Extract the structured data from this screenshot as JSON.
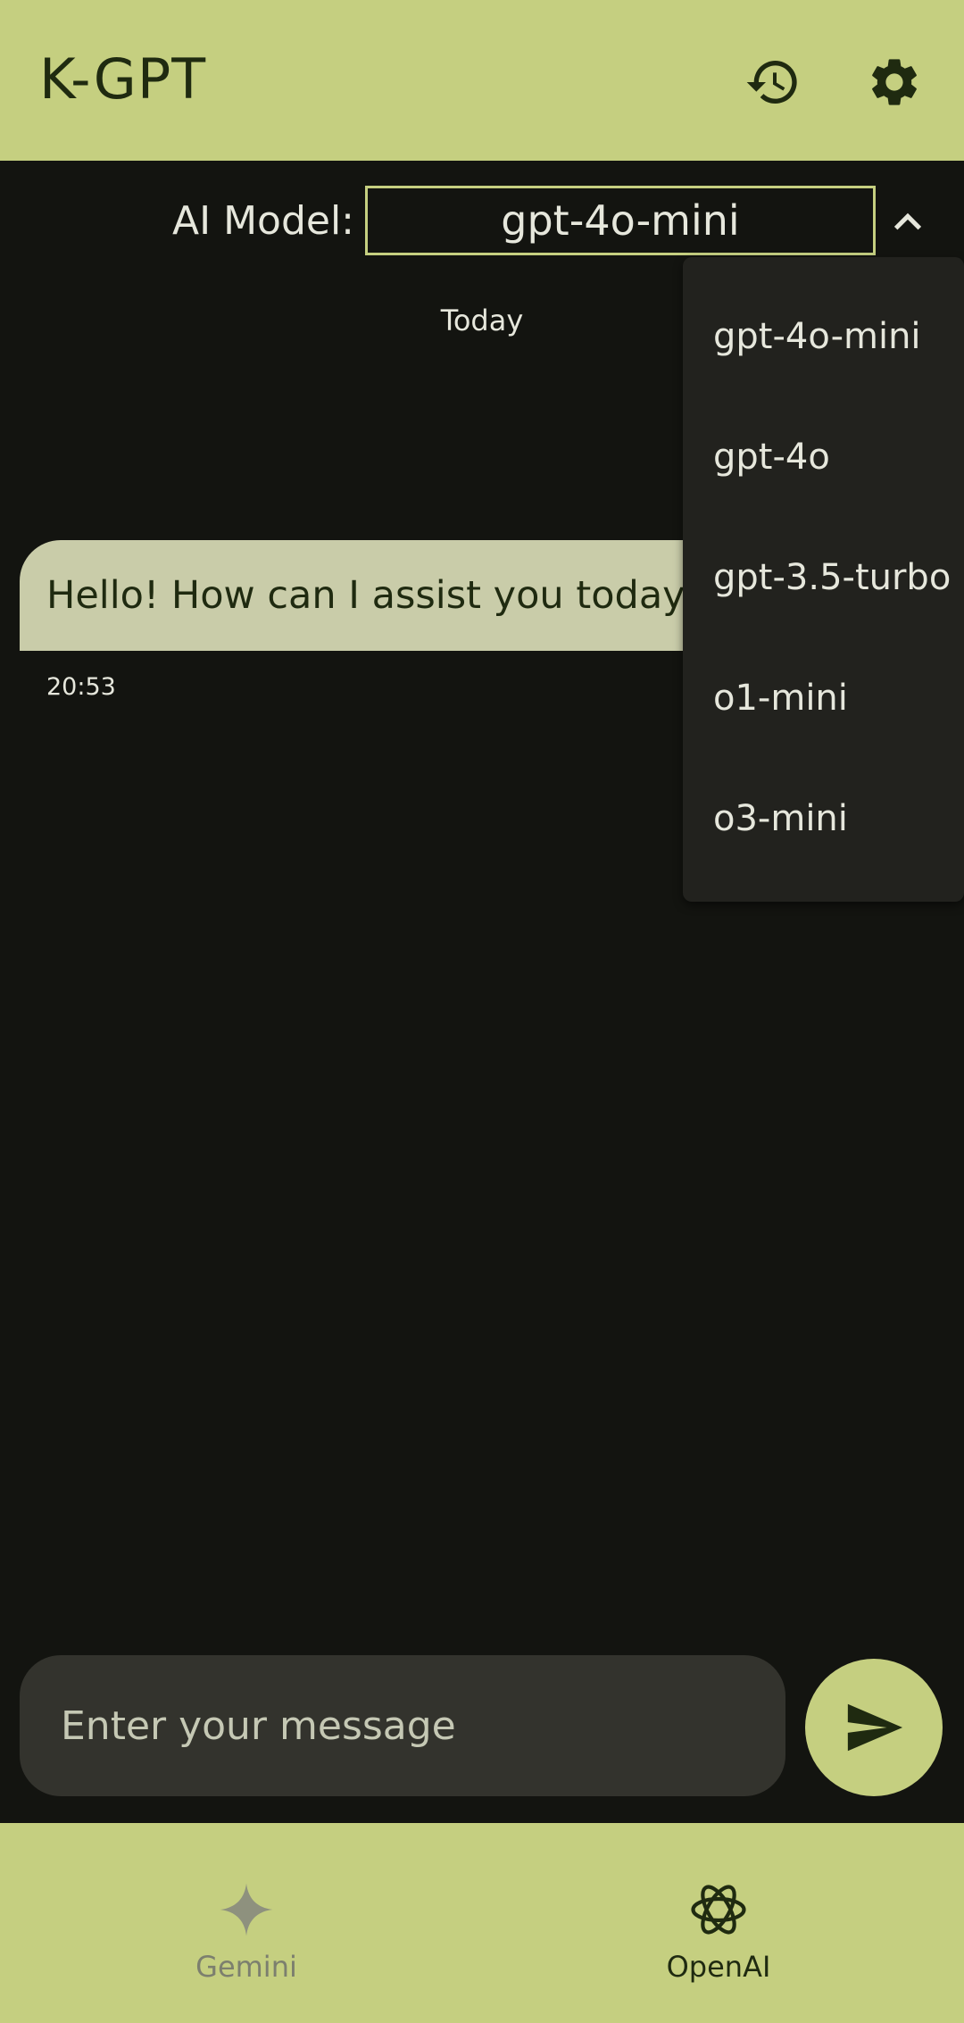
{
  "header": {
    "title": "K-GPT",
    "history_icon": "history-icon",
    "settings_icon": "gear-icon"
  },
  "model_selector": {
    "label": "AI Model:",
    "selected": "gpt-4o-mini",
    "chevron_icon": "chevron-up-icon",
    "options": [
      "gpt-4o-mini",
      "gpt-4o",
      "gpt-3.5-turbo",
      "o1-mini",
      "o3-mini"
    ]
  },
  "chat": {
    "date_label": "Today",
    "messages": [
      {
        "text": "Hello! How can I assist you today?",
        "time": "20:53"
      }
    ]
  },
  "composer": {
    "placeholder": "Enter your message",
    "send_icon": "send-icon"
  },
  "bottom_nav": {
    "items": [
      {
        "label": "Gemini",
        "icon": "sparkle-icon",
        "active": false
      },
      {
        "label": "OpenAI",
        "icon": "openai-icon",
        "active": true
      }
    ]
  },
  "colors": {
    "accent": "#c5cf80",
    "background": "#131410",
    "bubble": "#c9cca9",
    "dropdown": "#22221e",
    "input": "#33332d"
  }
}
